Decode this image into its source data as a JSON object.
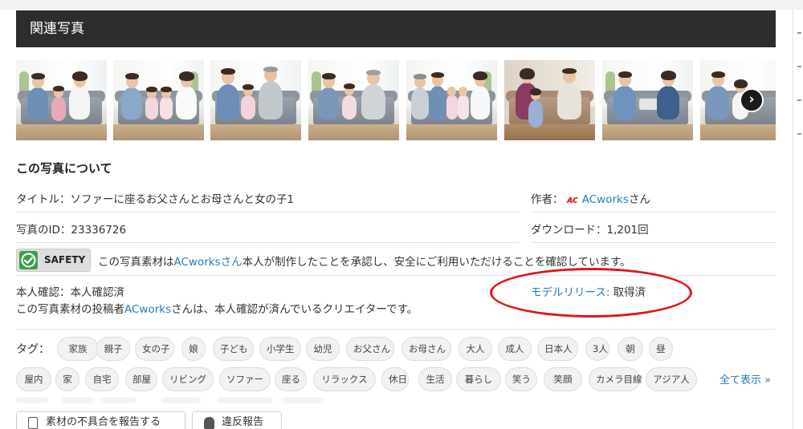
{
  "section": {
    "title": "関連写真"
  },
  "photos": [
    {
      "alt": "photo-1"
    },
    {
      "alt": "photo-2"
    },
    {
      "alt": "photo-3"
    },
    {
      "alt": "photo-4"
    },
    {
      "alt": "photo-5"
    },
    {
      "alt": "photo-6"
    },
    {
      "alt": "photo-7"
    },
    {
      "alt": "photo-8"
    }
  ],
  "carousel": {
    "next_glyph": "›"
  },
  "about": {
    "heading": "この写真について",
    "title_label": "タイトル：ソファーに座るお父さんとお母さんと女の子1",
    "id_label": "写真のID：23336726",
    "author_prefix": "作者：",
    "author_logo": "ᴀc",
    "author_name": "ACworks",
    "author_suffix": "さん",
    "download_label": "ダウンロード：1,201回"
  },
  "safety": {
    "badge": "SAFETY",
    "text_prefix": "この写真素材は",
    "text_link": "ACworksさん",
    "text_suffix": "本人が制作したことを承認し、安全にご利用いただけることを確認しています。"
  },
  "verification": {
    "label": "本人確認：",
    "value": "本人確認済",
    "desc_prefix": "この写真素材の投稿者",
    "desc_link": "ACworks",
    "desc_suffix": "さんは、本人確認が済んでいるクリエイターです。"
  },
  "model_release": {
    "label": "モデルリリース:",
    "value": "取得済"
  },
  "tags": {
    "label": "タグ：",
    "row1": [
      "家族",
      "親子",
      "女の子",
      "娘",
      "子ども",
      "小学生",
      "幼児",
      "お父さん",
      "お母さん",
      "大人",
      "成人",
      "日本人",
      "3人",
      "朝",
      "昼"
    ],
    "row2": [
      "屋内",
      "家",
      "自宅",
      "部屋",
      "リビング",
      "ソファー",
      "座る",
      "リラックス",
      "休日",
      "生活",
      "暮らし",
      "笑う",
      "笑顔",
      "カメラ目線",
      "アジア人"
    ],
    "show_all": "全て表示 »"
  },
  "reports": {
    "defect": "素材の不具合を報告する",
    "violation": "違反報告"
  },
  "colors": {
    "header_bg": "#2d2d2d",
    "link": "#2a7ab8",
    "safety_green": "#3aa14a",
    "highlight": "#e0161b"
  }
}
